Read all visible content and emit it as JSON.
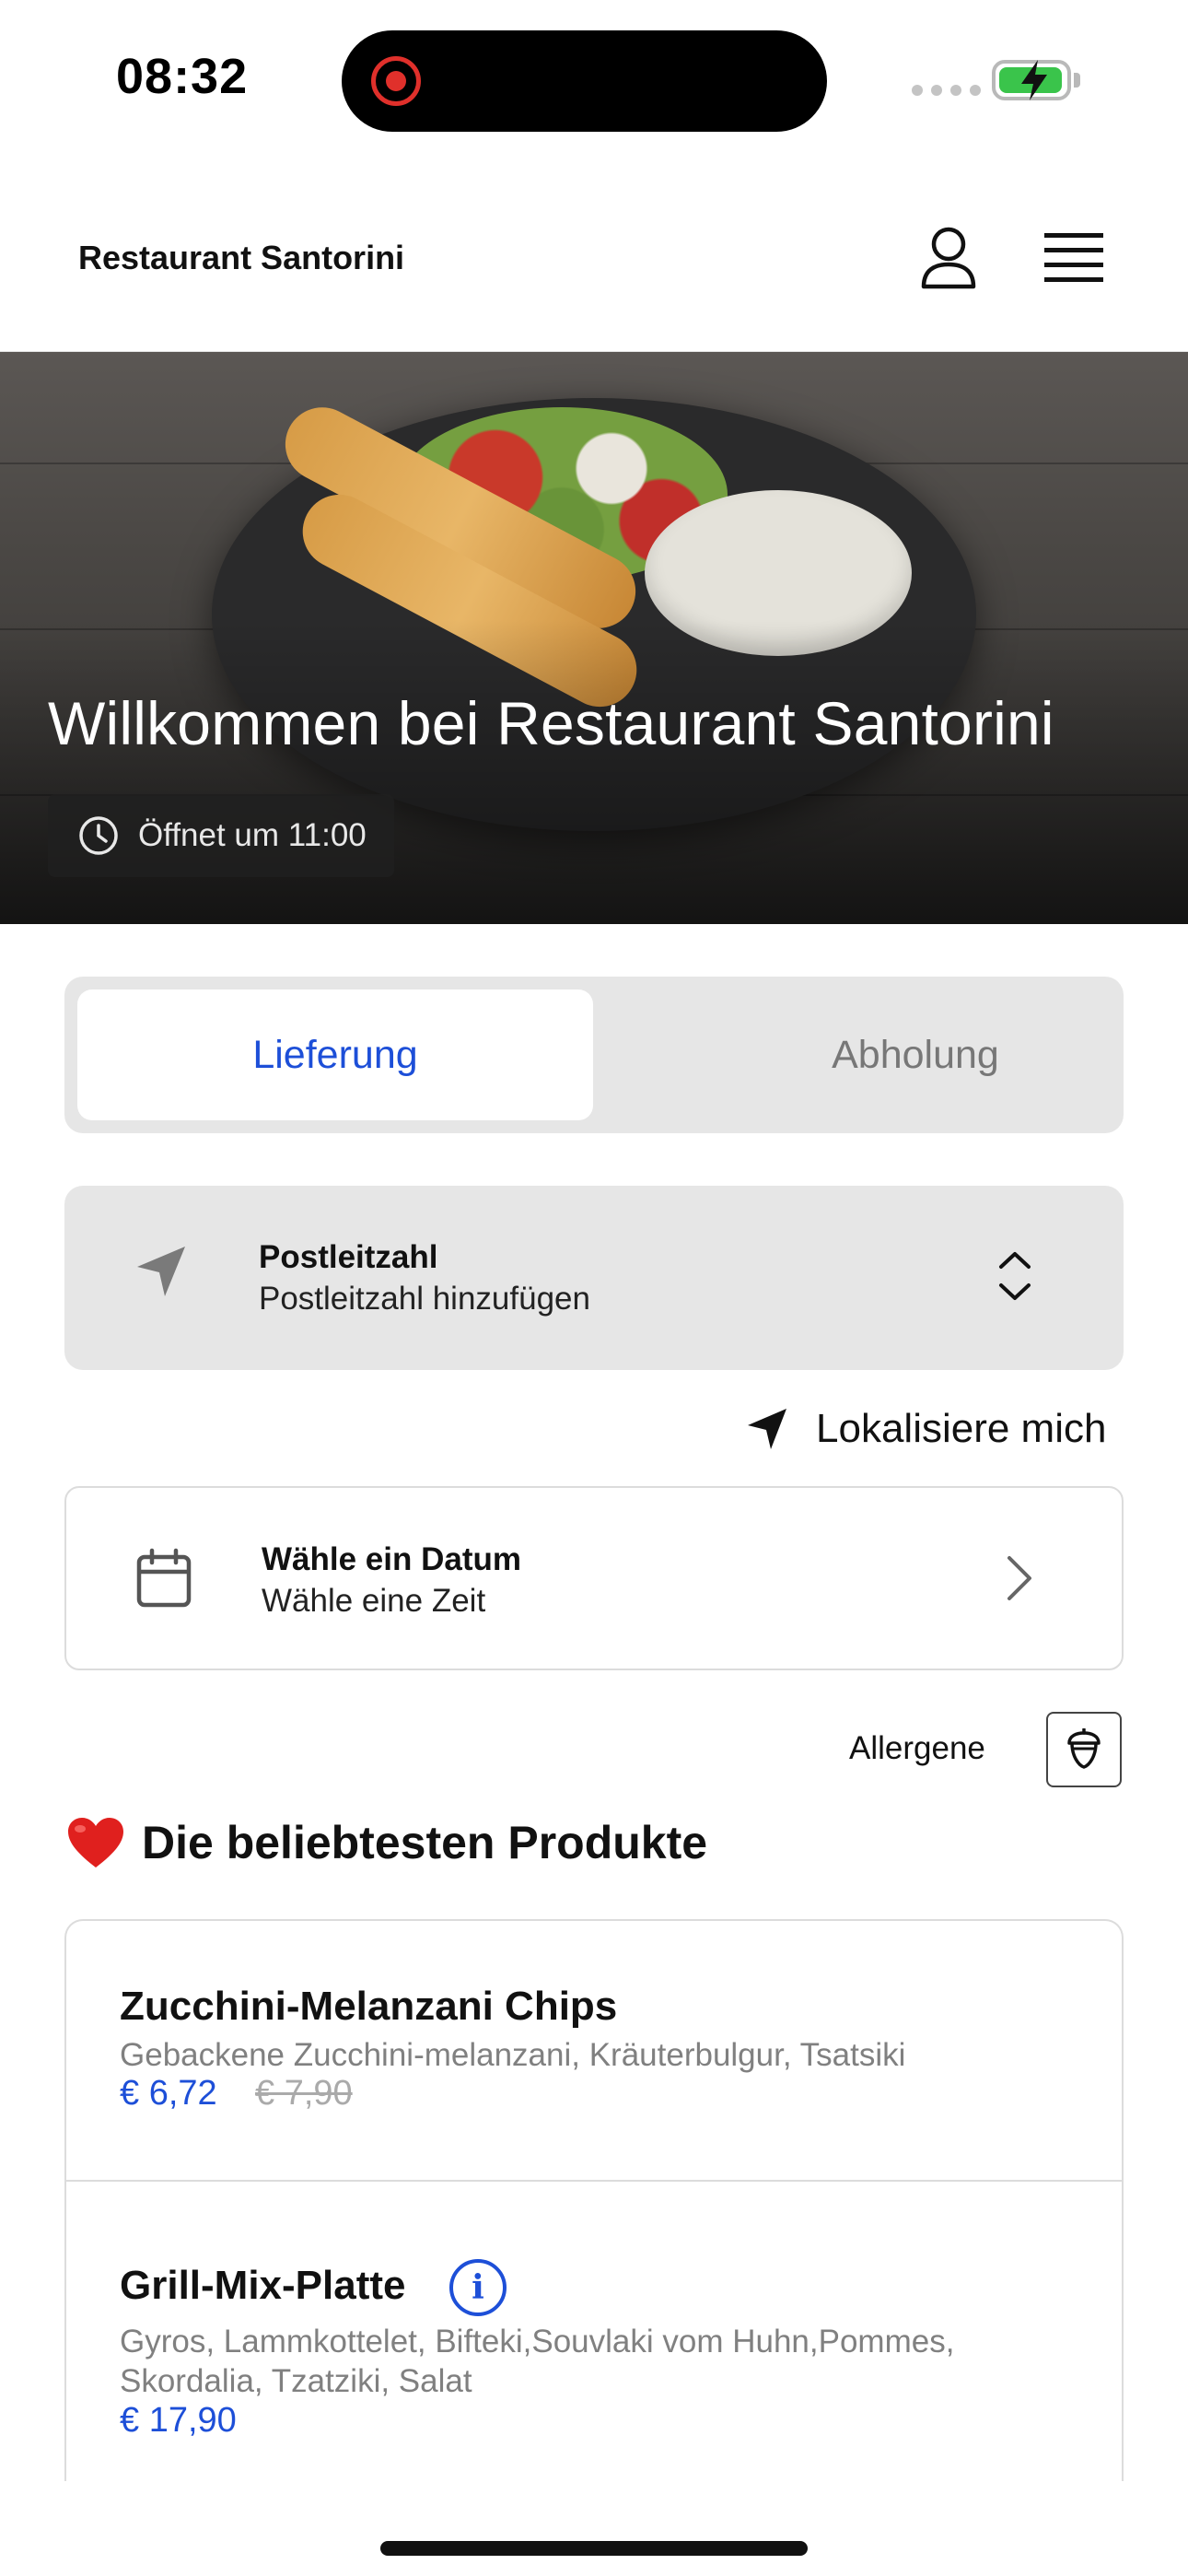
{
  "status_bar": {
    "time": "08:32"
  },
  "header": {
    "title": "Restaurant Santorini"
  },
  "hero": {
    "title": "Willkommen bei Restaurant Santorini",
    "opening_text": "Öffnet um 11:00"
  },
  "order_type": {
    "options": [
      "Lieferung",
      "Abholung"
    ],
    "selected": "Lieferung"
  },
  "postcode": {
    "label": "Postleitzahl",
    "placeholder": "Postleitzahl hinzufügen"
  },
  "locate_me": "Lokalisiere mich",
  "date_picker": {
    "label": "Wähle ein Datum",
    "value": "Wähle eine Zeit"
  },
  "allergens_label": "Allergene",
  "popular": {
    "emoji": "❤️",
    "title": "Die beliebtesten Produkte",
    "products": [
      {
        "name": "Zucchini-Melanzani Chips",
        "description": "Gebackene Zucchini-melanzani, Kräuterbulgur, Tsatsiki",
        "price": "€ 6,72",
        "old_price": "€ 7,90"
      },
      {
        "name": "Grill-Mix-Platte",
        "description": "Gyros, Lammkottelet, Bifteki,Souvlaki vom Huhn,Pommes, Skordalia, Tzatziki, Salat",
        "price": "€ 17,90"
      }
    ]
  },
  "colors": {
    "accent": "#1d4fd8",
    "field_background": "#e6e6e6",
    "muted_text": "#808080"
  }
}
